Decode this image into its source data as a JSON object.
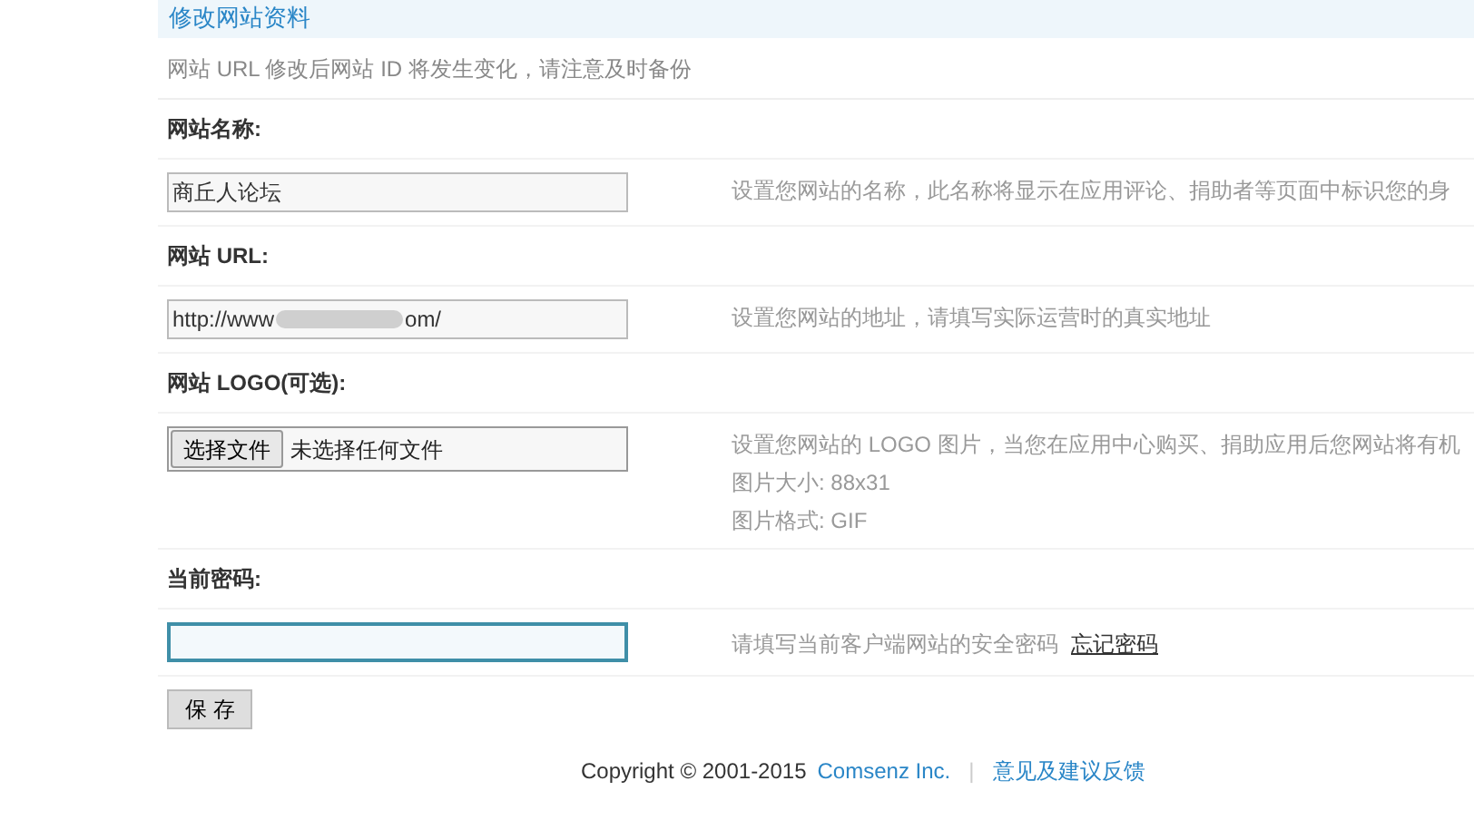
{
  "section_title": "修改网站资料",
  "notice": "网站 URL 修改后网站 ID 将发生变化，请注意及时备份",
  "fields": [
    {
      "kind": "text",
      "label": "网站名称:",
      "value": "商丘人论坛",
      "descriptions": [
        "设置您网站的名称，此名称将显示在应用评论、捐助者等页面中标识您的身"
      ]
    },
    {
      "kind": "redacted",
      "label": "网站 URL:",
      "value_start": "http://www",
      "value_end": "om/",
      "descriptions": [
        "设置您网站的地址，请填写实际运营时的真实地址"
      ]
    },
    {
      "kind": "file",
      "label": "网站 LOGO(可选):",
      "button": "选择文件",
      "status": "未选择任何文件",
      "descriptions": [
        "设置您网站的 LOGO 图片，当您在应用中心购买、捐助应用后您网站将有机",
        "图片大小: 88x31",
        "图片格式: GIF"
      ]
    },
    {
      "kind": "password",
      "label": "当前密码:",
      "focused": true,
      "descriptions": [
        "请填写当前客户端网站的安全密码"
      ],
      "link": "忘记密码"
    }
  ],
  "save_button": "保 存",
  "footer": {
    "copyright": "Copyright © 2001-2015",
    "company": "Comsenz Inc.",
    "separator": "|",
    "feedback": "意见及建议反馈"
  }
}
